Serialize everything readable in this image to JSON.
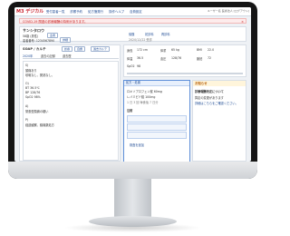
{
  "app": {
    "logo": "M3 デジカル",
    "nav": [
      "受付患者一覧",
      "診察予約",
      "処方箋発行",
      "操作ヘルプ",
      "自費設定"
    ],
    "header_right": "ユーザー名  医療法人  [ログアウト]"
  },
  "alert": {
    "text": "COVID-19 関連の診療報酬の特例があります。",
    "close": "×"
  },
  "patient": {
    "name": "サンシタロウ",
    "name_tag": "男性",
    "id_label": "58歳 (男性)",
    "id_btn": "患者",
    "record": "患者番号: 1234567890",
    "record_btn": "詳細",
    "actions": [
      "保険",
      "初診料",
      "再診料"
    ],
    "visit_date": "2020/12/22 受診"
  },
  "soap": {
    "title": "SOAP / カルテ",
    "toggle": "診療",
    "mode": "自費",
    "history_btn": "過去カルテ",
    "tabs": [
      "2020年",
      "過去の記録",
      "過去歴"
    ],
    "body_lines": [
      "S)",
      "頭痛あり",
      "咳嗽なし、発熱なし。",
      "",
      "O)",
      "BT 36.5℃",
      "BP 128/76",
      "SpO2 98%",
      "",
      "A)",
      "緊張型頭痛の疑い",
      "",
      "P)",
      "経過観察、鎮痛薬処方"
    ]
  },
  "vitals": {
    "labels": [
      "身長",
      "体重",
      "BMI",
      "体温",
      "血圧",
      "脈拍",
      "SpO2"
    ],
    "values": [
      "172 cm",
      "65 kg",
      "22.0",
      "36.5",
      "128/76",
      "72",
      "98"
    ]
  },
  "orders": {
    "title": "処方・処置",
    "items": [
      "ロキソプロフェン錠 60mg",
      "レバミピド錠 100mg",
      "1 日 3 回 毎食後 7 日分"
    ],
    "section": "注射",
    "buttons": [
      "処方を追加",
      "処置を追加",
      "検査を追加"
    ]
  },
  "right_panel": {
    "title": "お知らせ",
    "subtitle": "診療報酬改定について",
    "lines": [
      "算定の変更があります",
      "詳細はこちらをご確認ください。"
    ]
  }
}
